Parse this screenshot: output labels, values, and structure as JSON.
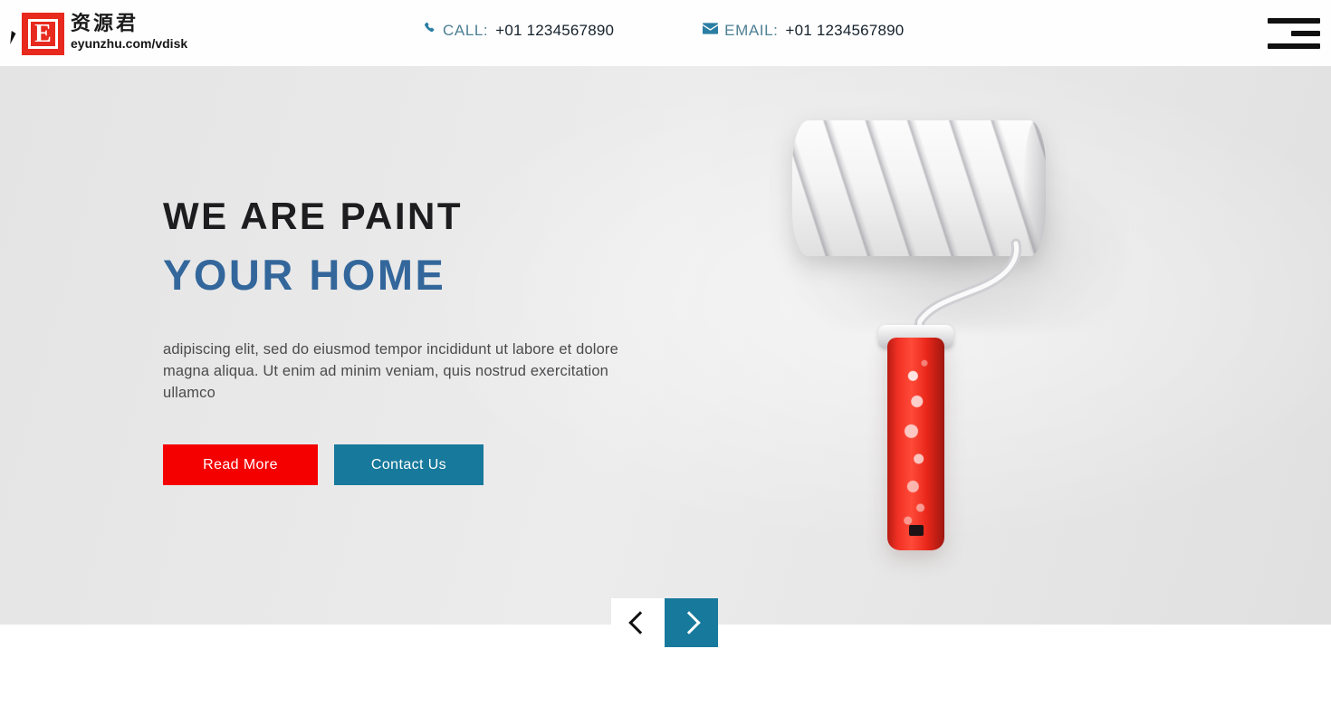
{
  "header": {
    "logo": {
      "mark_letter": "E",
      "cn_text": "资源君",
      "url_text": "eyunzhu.com/vdisk",
      "mark_color": "#e8291e"
    },
    "contacts": [
      {
        "icon": "phone-icon",
        "glyph": "✆",
        "label": "CALL:",
        "value": "+01 1234567890"
      },
      {
        "icon": "envelope-icon",
        "glyph": "✉",
        "label": "EMAIL:",
        "value": "+01 1234567890"
      }
    ],
    "menu_label": "Menu"
  },
  "hero": {
    "headline_top": "WE ARE PAINT",
    "headline_bottom": "YOUR HOME",
    "paragraph": "adipiscing elit, sed do eiusmod tempor incididunt ut labore et dolore magna aliqua. Ut enim ad minim veniam, quis nostrud exercitation ullamco",
    "primary_button": "Read More",
    "secondary_button": "Contact Us",
    "image_alt": "paint-roller",
    "colors": {
      "background": "#e5e5e5",
      "headline_top": "#1d1d1f",
      "headline_bottom": "#33679b",
      "primary_button": "#f50000",
      "secondary_button": "#17799b"
    }
  },
  "slider": {
    "prev_label": "‹",
    "next_label": "›",
    "prev_name": "previous-slide",
    "next_name": "next-slide"
  }
}
